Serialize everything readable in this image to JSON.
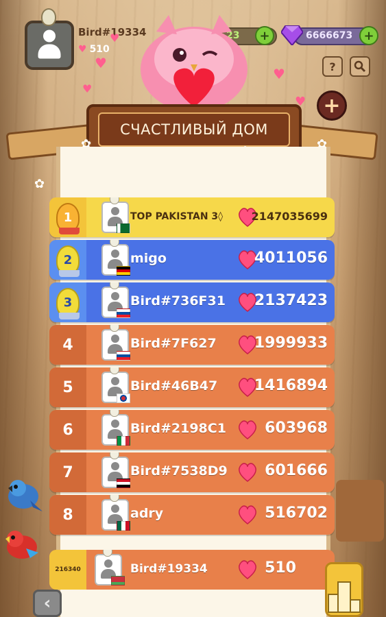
{
  "player": {
    "name": "Bird#19334",
    "hearts": "510"
  },
  "currency": {
    "coins": "23",
    "gems": "6666673"
  },
  "buttons": {
    "help": "?",
    "close": "+",
    "back": "‹"
  },
  "banner": {
    "title": "СЧАСТЛИВЫЙ ДОМ"
  },
  "leaderboard": {
    "rows": [
      {
        "rank": "1",
        "name": "TOP PAKISTAN 3◊",
        "score": "2147035699",
        "flag": "pakistan"
      },
      {
        "rank": "2",
        "name": "migo",
        "score": "4011056",
        "flag": "germany"
      },
      {
        "rank": "3",
        "name": "Bird#736F31",
        "score": "2137423",
        "flag": "slovakia"
      },
      {
        "rank": "4",
        "name": "Bird#7F627",
        "score": "1999933",
        "flag": "slovakia"
      },
      {
        "rank": "5",
        "name": "Bird#46B47",
        "score": "1416894",
        "flag": "south-korea"
      },
      {
        "rank": "6",
        "name": "Bird#2198C1",
        "score": "603968",
        "flag": "italy"
      },
      {
        "rank": "7",
        "name": "Bird#7538D9",
        "score": "601666",
        "flag": "egypt"
      },
      {
        "rank": "8",
        "name": "adry",
        "score": "516702",
        "flag": "mexico"
      }
    ],
    "self": {
      "rank": "216340",
      "name": "Bird#19334",
      "score": "510",
      "flag": "belarus"
    }
  },
  "colors": {
    "gold_row": "#f6d84a",
    "blue_row": "#4a72e6",
    "orange_row": "#e8804a",
    "heart": "#ff4f7f"
  }
}
